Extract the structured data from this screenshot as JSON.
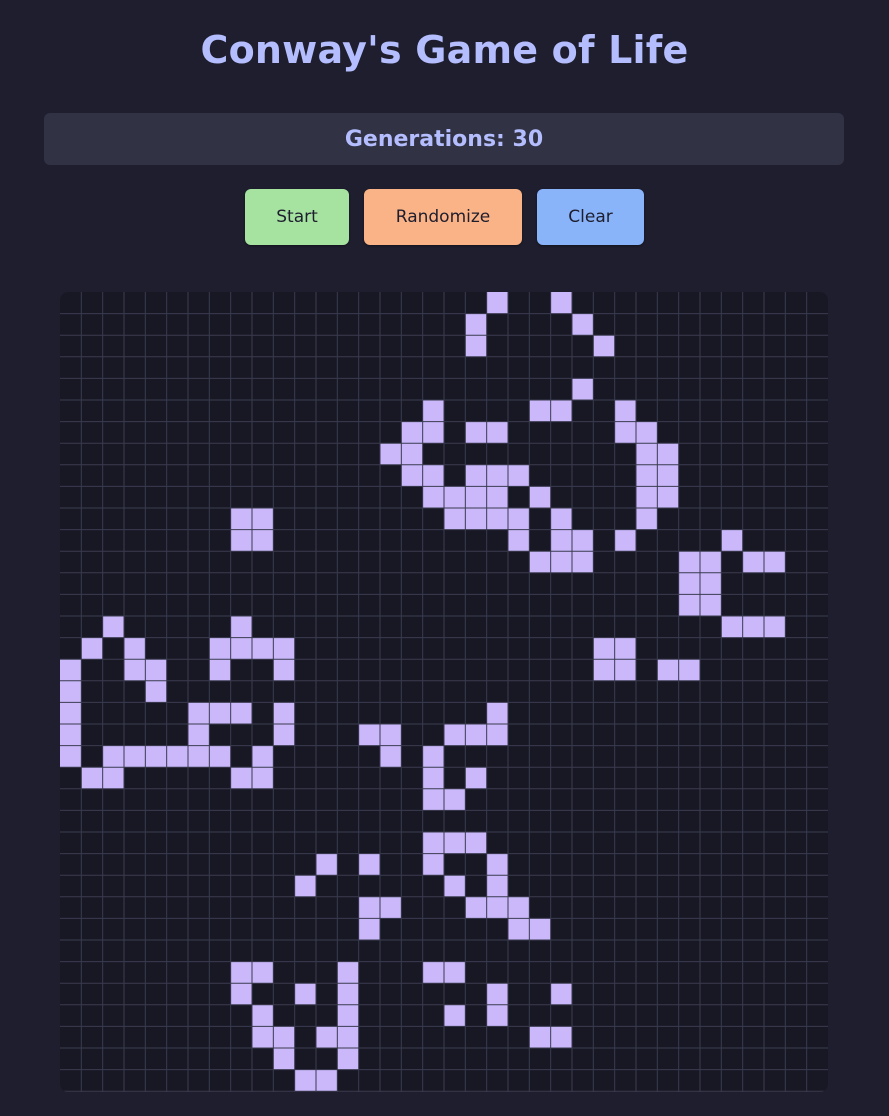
{
  "header": {
    "title": "Conway's Game of Life"
  },
  "status": {
    "generations_label": "Generations:",
    "generations_value": "30"
  },
  "controls": {
    "start_label": "Start",
    "randomize_label": "Randomize",
    "clear_label": "Clear"
  },
  "colors": {
    "background": "#1e1e2e",
    "panel": "#313244",
    "board": "#181825",
    "grid_line": "#3a3b4f",
    "alive_cell": "#cbb8fb",
    "title": "#b4befe",
    "start": "#a6e3a1",
    "randomize": "#fab387",
    "clear": "#89b4fa"
  },
  "board": {
    "columns": 36,
    "rows": 37,
    "live_cells": [
      [
        0,
        20
      ],
      [
        0,
        23
      ],
      [
        1,
        19
      ],
      [
        1,
        24
      ],
      [
        2,
        19
      ],
      [
        2,
        25
      ],
      [
        4,
        24
      ],
      [
        5,
        17
      ],
      [
        5,
        22
      ],
      [
        5,
        23
      ],
      [
        5,
        26
      ],
      [
        6,
        16
      ],
      [
        6,
        17
      ],
      [
        6,
        19
      ],
      [
        6,
        20
      ],
      [
        6,
        26
      ],
      [
        6,
        27
      ],
      [
        7,
        15
      ],
      [
        7,
        16
      ],
      [
        7,
        27
      ],
      [
        7,
        28
      ],
      [
        8,
        16
      ],
      [
        8,
        17
      ],
      [
        8,
        19
      ],
      [
        8,
        20
      ],
      [
        8,
        21
      ],
      [
        8,
        27
      ],
      [
        8,
        28
      ],
      [
        9,
        17
      ],
      [
        9,
        18
      ],
      [
        9,
        19
      ],
      [
        9,
        20
      ],
      [
        9,
        22
      ],
      [
        9,
        27
      ],
      [
        9,
        28
      ],
      [
        10,
        8
      ],
      [
        10,
        9
      ],
      [
        10,
        18
      ],
      [
        10,
        19
      ],
      [
        10,
        20
      ],
      [
        10,
        21
      ],
      [
        10,
        23
      ],
      [
        10,
        27
      ],
      [
        11,
        8
      ],
      [
        11,
        9
      ],
      [
        11,
        21
      ],
      [
        11,
        23
      ],
      [
        11,
        24
      ],
      [
        11,
        26
      ],
      [
        11,
        31
      ],
      [
        12,
        22
      ],
      [
        12,
        23
      ],
      [
        12,
        24
      ],
      [
        12,
        29
      ],
      [
        12,
        30
      ],
      [
        12,
        32
      ],
      [
        12,
        33
      ],
      [
        13,
        29
      ],
      [
        13,
        30
      ],
      [
        14,
        29
      ],
      [
        14,
        30
      ],
      [
        15,
        2
      ],
      [
        15,
        8
      ],
      [
        15,
        31
      ],
      [
        15,
        32
      ],
      [
        15,
        33
      ],
      [
        16,
        1
      ],
      [
        16,
        3
      ],
      [
        16,
        7
      ],
      [
        16,
        8
      ],
      [
        16,
        9
      ],
      [
        16,
        10
      ],
      [
        16,
        25
      ],
      [
        16,
        26
      ],
      [
        17,
        0
      ],
      [
        17,
        3
      ],
      [
        17,
        4
      ],
      [
        17,
        7
      ],
      [
        17,
        10
      ],
      [
        17,
        25
      ],
      [
        17,
        26
      ],
      [
        17,
        28
      ],
      [
        17,
        29
      ],
      [
        18,
        0
      ],
      [
        18,
        4
      ],
      [
        19,
        0
      ],
      [
        19,
        6
      ],
      [
        19,
        7
      ],
      [
        19,
        8
      ],
      [
        19,
        10
      ],
      [
        19,
        20
      ],
      [
        20,
        0
      ],
      [
        20,
        6
      ],
      [
        20,
        10
      ],
      [
        20,
        14
      ],
      [
        20,
        15
      ],
      [
        20,
        18
      ],
      [
        20,
        19
      ],
      [
        20,
        20
      ],
      [
        21,
        0
      ],
      [
        21,
        2
      ],
      [
        21,
        3
      ],
      [
        21,
        4
      ],
      [
        21,
        5
      ],
      [
        21,
        6
      ],
      [
        21,
        7
      ],
      [
        21,
        9
      ],
      [
        21,
        15
      ],
      [
        21,
        17
      ],
      [
        22,
        1
      ],
      [
        22,
        2
      ],
      [
        22,
        8
      ],
      [
        22,
        9
      ],
      [
        22,
        17
      ],
      [
        22,
        19
      ],
      [
        23,
        17
      ],
      [
        23,
        18
      ],
      [
        25,
        17
      ],
      [
        25,
        18
      ],
      [
        25,
        19
      ],
      [
        26,
        12
      ],
      [
        26,
        14
      ],
      [
        26,
        17
      ],
      [
        26,
        20
      ],
      [
        27,
        11
      ],
      [
        27,
        18
      ],
      [
        27,
        20
      ],
      [
        28,
        14
      ],
      [
        28,
        15
      ],
      [
        28,
        19
      ],
      [
        28,
        20
      ],
      [
        28,
        21
      ],
      [
        29,
        14
      ],
      [
        29,
        21
      ],
      [
        29,
        22
      ],
      [
        31,
        8
      ],
      [
        31,
        9
      ],
      [
        31,
        13
      ],
      [
        31,
        17
      ],
      [
        31,
        18
      ],
      [
        32,
        8
      ],
      [
        32,
        11
      ],
      [
        32,
        13
      ],
      [
        32,
        20
      ],
      [
        32,
        23
      ],
      [
        33,
        9
      ],
      [
        33,
        13
      ],
      [
        33,
        18
      ],
      [
        33,
        20
      ],
      [
        34,
        9
      ],
      [
        34,
        10
      ],
      [
        34,
        12
      ],
      [
        34,
        13
      ],
      [
        34,
        22
      ],
      [
        34,
        23
      ],
      [
        35,
        10
      ],
      [
        35,
        13
      ],
      [
        36,
        11
      ],
      [
        36,
        12
      ]
    ]
  }
}
